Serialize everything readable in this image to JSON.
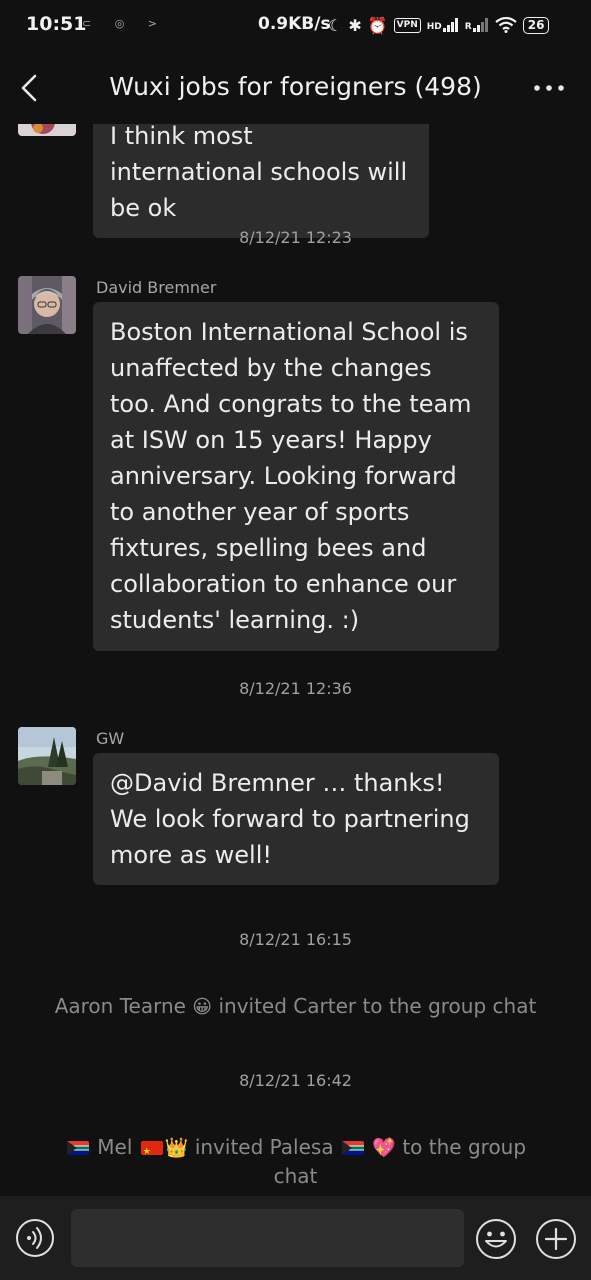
{
  "status_bar": {
    "time": "10:51",
    "notif_icons": "⊂ ◎ >",
    "speed": "0.9KB/s",
    "moon_icon": "☾",
    "bluetooth_icon": "✱",
    "alarm_icon": "⏰",
    "vpn": "VPN",
    "hd": "HD",
    "r": "R",
    "battery": "26"
  },
  "header": {
    "title": "Wuxi jobs for foreigners (498)"
  },
  "messages": [
    {
      "text": "I think most international schools will be ok"
    },
    {
      "timestamp": "8/12/21 12:23"
    },
    {
      "sender": "David Bremner",
      "text": "Boston International School is unaffected by the changes too. And congrats to the team at ISW on 15 years! Happy anniversary. Looking forward to another year of sports fixtures, spelling bees and collaboration to enhance our students' learning. :)"
    },
    {
      "timestamp": "8/12/21 12:36"
    },
    {
      "sender": "GW",
      "text": "@David Bremner … thanks! We look forward to partnering more as well!"
    },
    {
      "timestamp": "8/12/21 16:15"
    },
    {
      "system": {
        "actor": "Aaron Tearne",
        "actor_emoji": "😀",
        "rest": "invited Carter to the group chat"
      }
    },
    {
      "timestamp": "8/12/21 16:42"
    },
    {
      "system": {
        "actor": "Mel",
        "crown": "👑",
        "action": "invited Palesa",
        "heart": "💖",
        "rest": "to the group chat"
      }
    }
  ],
  "input": {
    "placeholder": ""
  }
}
